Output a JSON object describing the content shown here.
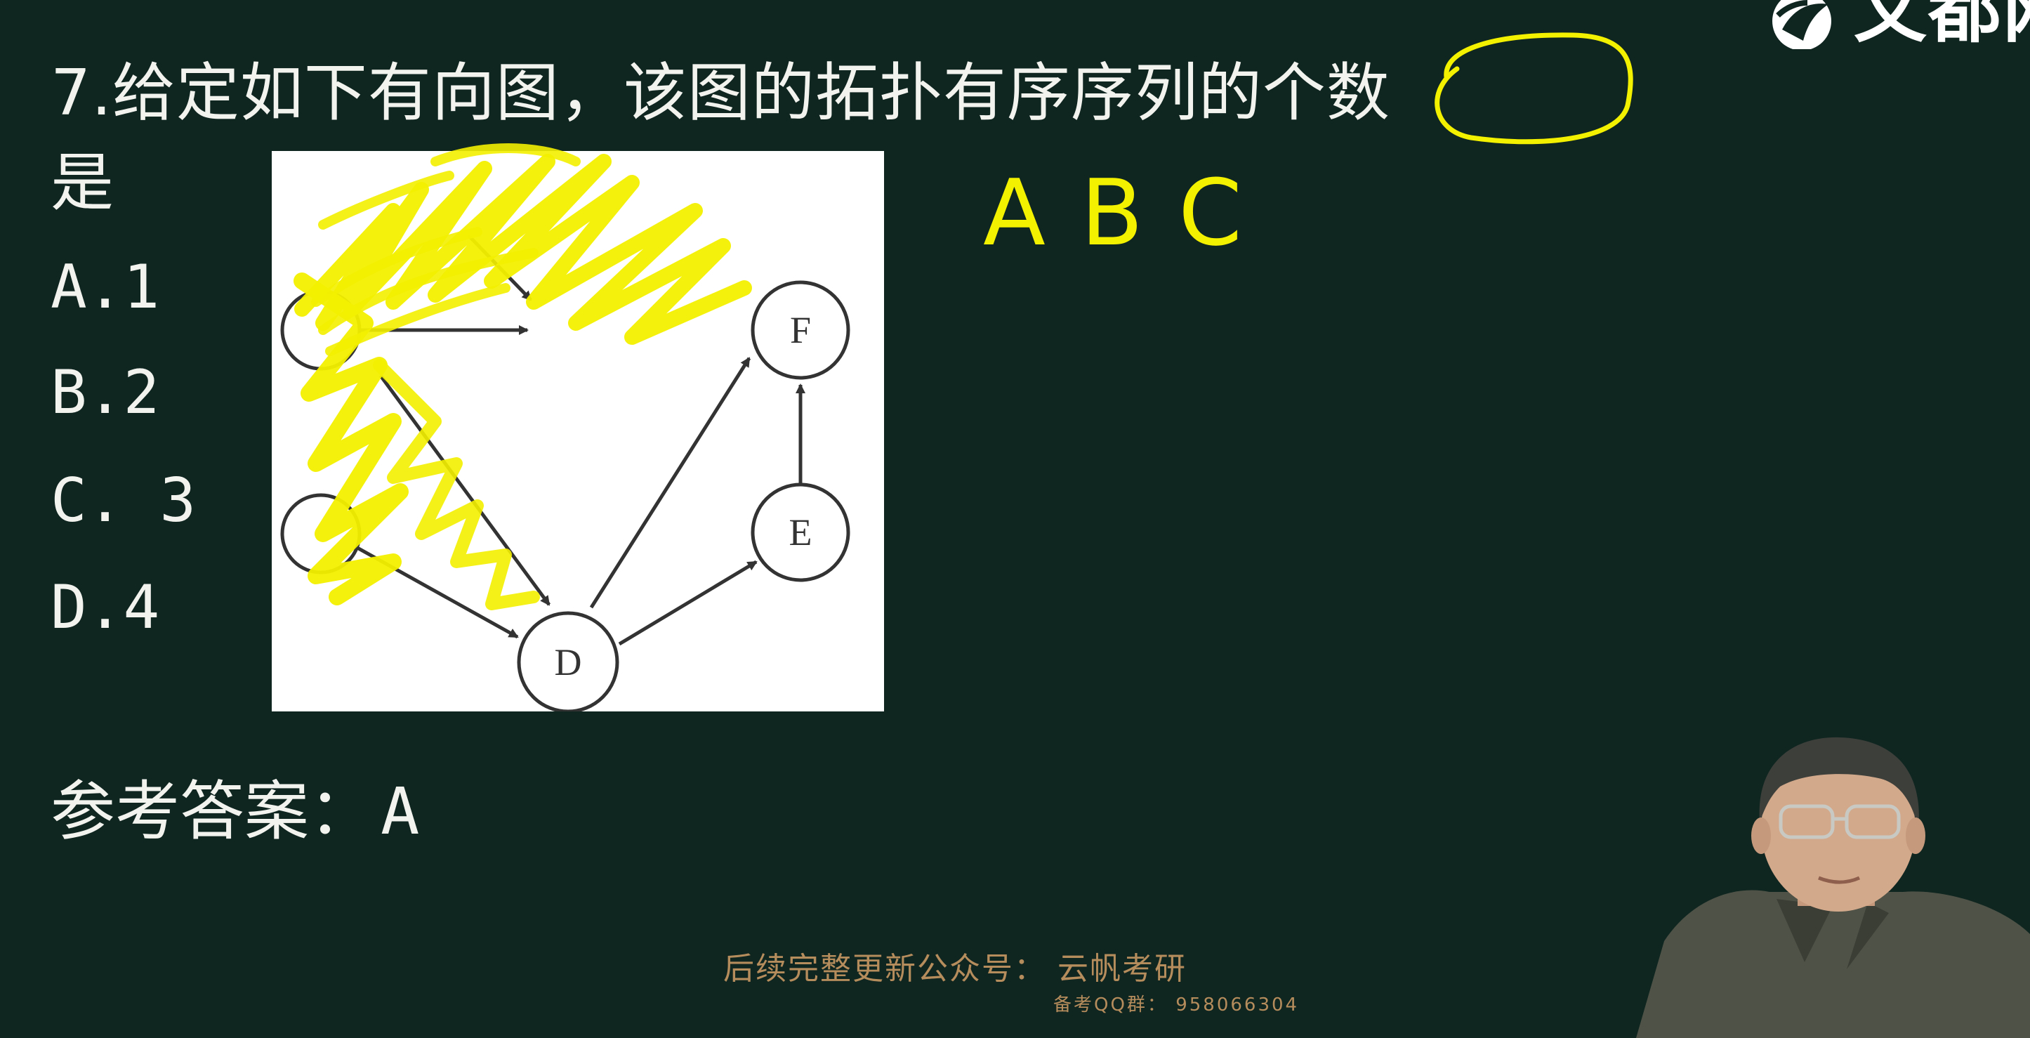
{
  "question": {
    "line1": "7.给定如下有向图，该图的拓扑有序序列的个数",
    "line2": "是"
  },
  "options": [
    "A.1",
    "B.2",
    "C. 3",
    "D.4"
  ],
  "answer": {
    "label": "参考答案：",
    "value": "A"
  },
  "graph": {
    "nodes": [
      "F",
      "E",
      "D"
    ]
  },
  "annotation": {
    "letters": [
      "A",
      "B",
      "C"
    ]
  },
  "logo": {
    "text": "文都网"
  },
  "footer": {
    "main": "后续完整更新公众号：  云帆考研",
    "sub": "备考QQ群：  958066304"
  },
  "colors": {
    "background": "#0f2520",
    "highlight": "#f3f000",
    "footer": "#b58c5c"
  }
}
